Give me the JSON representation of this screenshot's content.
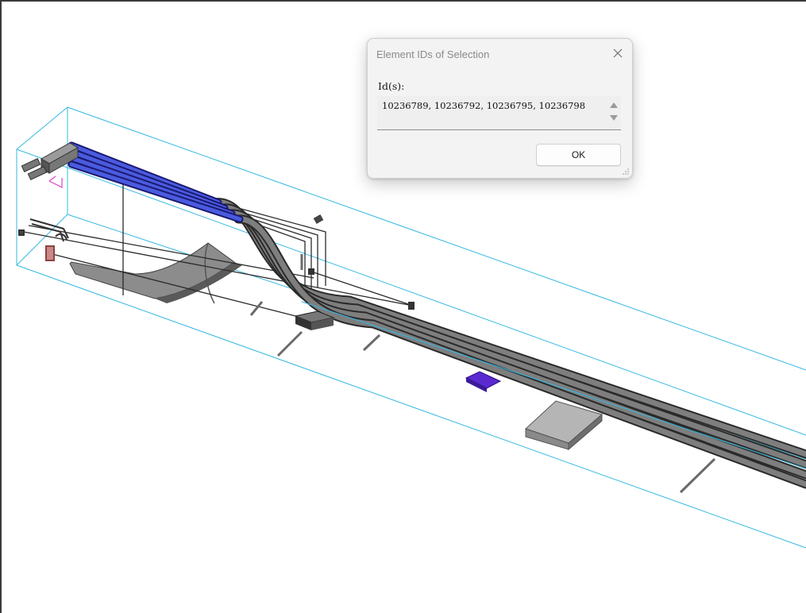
{
  "dialog": {
    "title": "Element IDs of Selection",
    "ids_label": "Id(s):",
    "ids_value": "10236789, 10236792, 10236795, 10236798",
    "ok_label": "OK"
  },
  "icons": {
    "close": "close-icon",
    "scroll_up": "scroll-up-arrow-icon",
    "scroll_down": "scroll-down-arrow-icon",
    "resize": "resize-grip-icon"
  },
  "colors": {
    "selection": "#4a5be0",
    "bounding_box": "#33b8e0",
    "pipe": "#5a5a5a",
    "floor_box": "#5a2ad0",
    "pink_marker": "#e040d0"
  }
}
